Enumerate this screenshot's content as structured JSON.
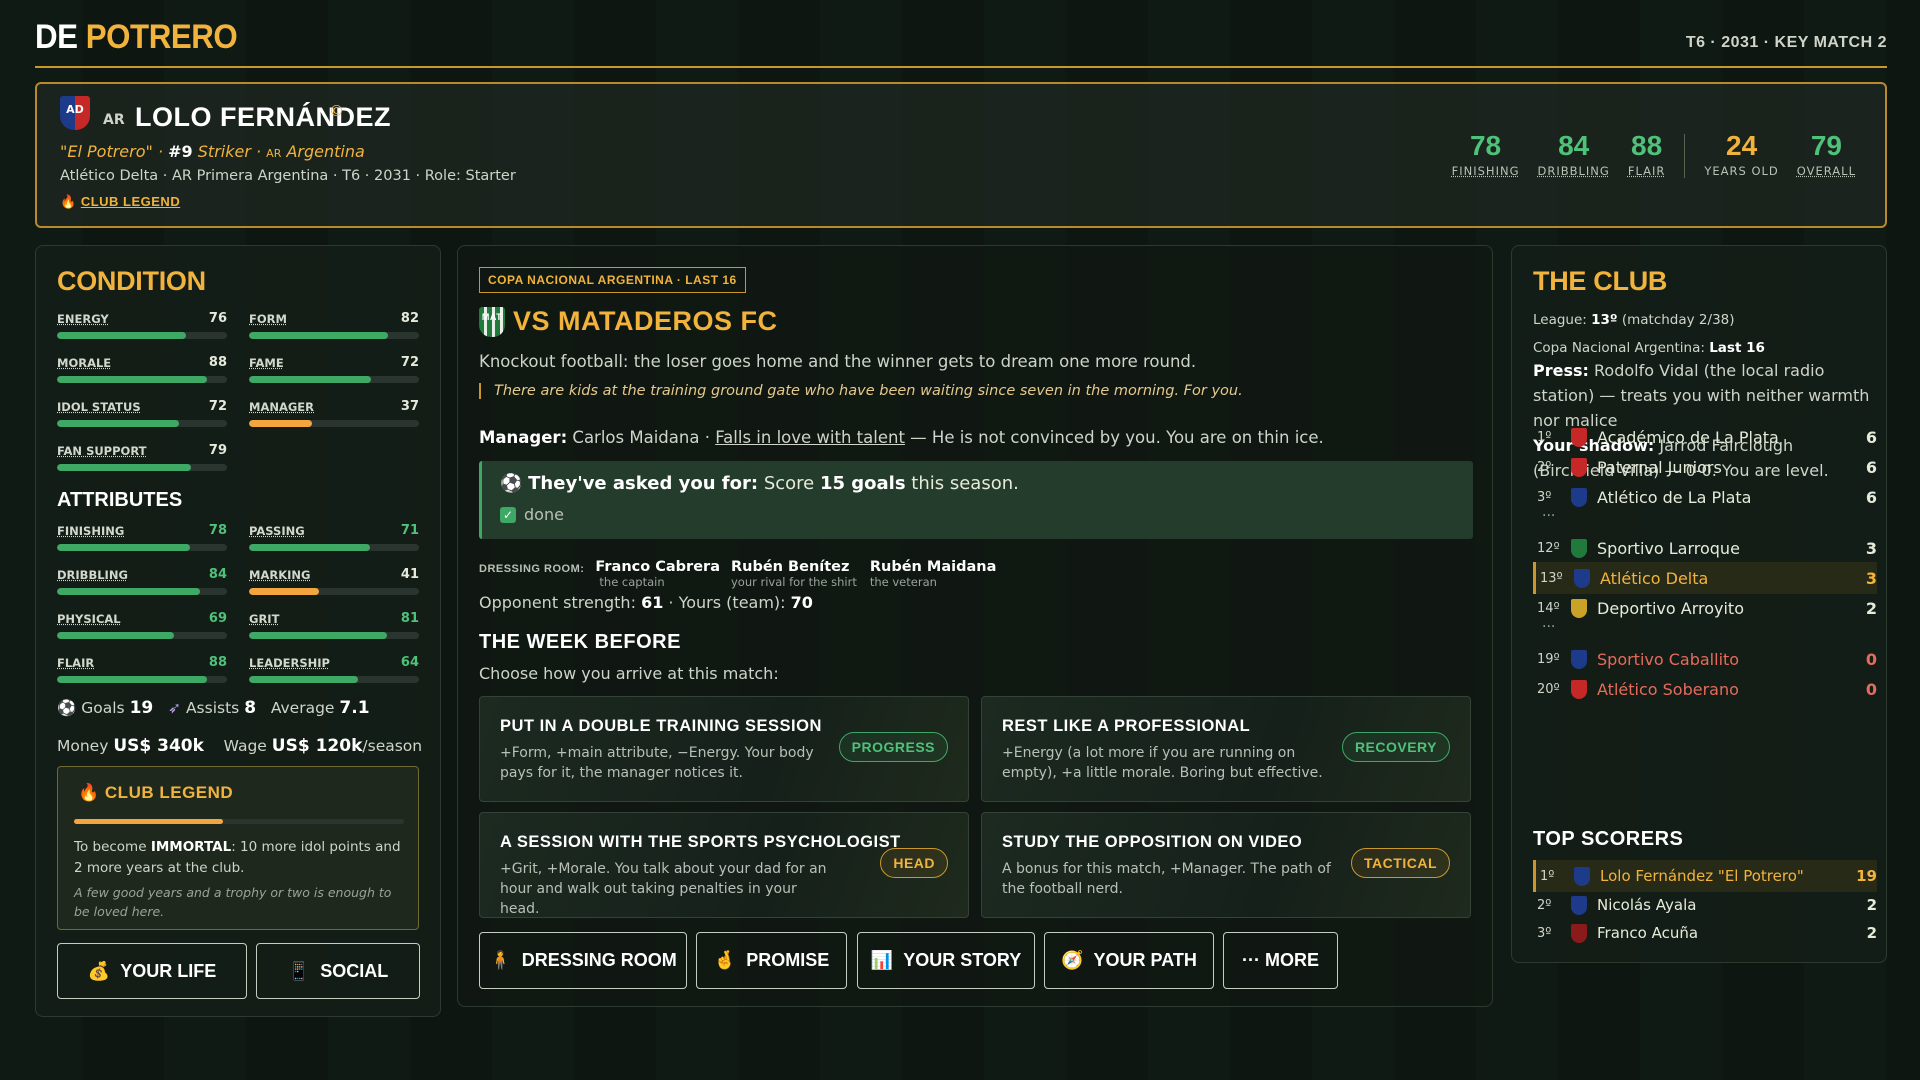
{
  "brand": {
    "part1": "DE",
    "part2": "POTRERO"
  },
  "season_info": "T6 · 2031 · KEY MATCH 2",
  "player": {
    "crest": "AD",
    "nationality": "AR",
    "name": "LOLO FERNÁNDEZ",
    "nickname": "\"El Potrero\"",
    "number": "#9",
    "position": "Striker",
    "nat_code": "AR",
    "country": "Argentina",
    "club_line": "Atlético Delta · AR Primera Argentina · T6 · 2031 · Role: Starter",
    "legend_label": "CLUB LEGEND",
    "stats": [
      {
        "label": "FINISHING",
        "value": "78"
      },
      {
        "label": "DRIBBLING",
        "value": "84"
      },
      {
        "label": "FLAIR",
        "value": "88"
      },
      {
        "label": "YEARS OLD",
        "value": "24"
      },
      {
        "label": "OVERALL",
        "value": "79"
      }
    ]
  },
  "condition": {
    "title": "CONDITION",
    "items": [
      {
        "label": "ENERGY",
        "value": "76",
        "level": 0.76,
        "color": "green"
      },
      {
        "label": "FORM",
        "value": "82",
        "level": 0.82,
        "color": "green"
      },
      {
        "label": "MORALE",
        "value": "88",
        "level": 0.88,
        "color": "green"
      },
      {
        "label": "FAME",
        "value": "72",
        "level": 0.72,
        "color": "green"
      },
      {
        "label": "IDOL STATUS",
        "value": "72",
        "level": 0.72,
        "color": "green"
      },
      {
        "label": "MANAGER",
        "value": "37",
        "level": 0.37,
        "color": "orange"
      },
      {
        "label": "FAN SUPPORT",
        "value": "79",
        "level": 0.79,
        "color": "green"
      }
    ]
  },
  "attributes": {
    "title": "ATTRIBUTES",
    "items": [
      {
        "label": "FINISHING",
        "value": "78",
        "level": 0.78,
        "color": "green"
      },
      {
        "label": "PASSING",
        "value": "71",
        "level": 0.71,
        "color": "green"
      },
      {
        "label": "DRIBBLING",
        "value": "84",
        "level": 0.84,
        "color": "green"
      },
      {
        "label": "MARKING",
        "value": "41",
        "level": 0.41,
        "color": "orange"
      },
      {
        "label": "PHYSICAL",
        "value": "69",
        "level": 0.69,
        "color": "green"
      },
      {
        "label": "GRIT",
        "value": "81",
        "level": 0.81,
        "color": "green"
      },
      {
        "label": "FLAIR",
        "value": "88",
        "level": 0.88,
        "color": "green"
      },
      {
        "label": "LEADERSHIP",
        "value": "64",
        "level": 0.64,
        "color": "green"
      }
    ]
  },
  "season_stats": {
    "goals_label": "Goals",
    "goals": "19",
    "assists_label": "Assists",
    "assists": "8",
    "average_label": "Average",
    "average": "7.1",
    "money_label": "Money",
    "money": "US$ 340k",
    "wage_label": "Wage",
    "wage": "US$ 120k",
    "wage_unit": "/season"
  },
  "legend_box": {
    "title": "CLUB LEGEND",
    "progress": 0.45,
    "text_pre": "To become ",
    "text_bold": "IMMORTAL",
    "text_post": ": 10 more idol points and 2 more years at the club.",
    "note": "A few good years and a trophy or two is enough to be loved here."
  },
  "left_buttons": {
    "life": "YOUR LIFE",
    "social": "SOCIAL"
  },
  "match": {
    "competition": "COPA NACIONAL ARGENTINA · LAST 16",
    "opp_crest": "MAT",
    "title": "VS MATADEROS FC",
    "description": "Knockout football: the loser goes home and the winner gets to dream one more round.",
    "quote": "There are kids at the training ground gate who have been waiting since seven in the morning. For you.",
    "manager_label": "Manager:",
    "manager_name": "Carlos Maidana",
    "manager_trait": "Falls in love with talent",
    "manager_note": "— He is not convinced by you. You are on thin ice.",
    "ask_label": "They've asked you for:",
    "ask_pre": "Score ",
    "ask_bold": "15 goals",
    "ask_post": " this season.",
    "ask_status": "done",
    "dressing_label": "DRESSING ROOM:",
    "dressing": [
      {
        "name": "Franco Cabrera",
        "role": "the captain"
      },
      {
        "name": "Rubén Benítez",
        "role": "your rival for the shirt"
      },
      {
        "name": "Rubén Maidana",
        "role": "the veteran"
      }
    ],
    "opp_strength_label": "Opponent strength:",
    "opp_strength": "61",
    "yours_label": "Yours (team):",
    "yours": "70",
    "week_title": "THE WEEK BEFORE",
    "week_sub": "Choose how you arrive at this match:",
    "options": [
      {
        "title": "PUT IN A DOUBLE TRAINING SESSION",
        "desc": "+Form, +main attribute, −Energy. Your body pays for it, the manager notices it.",
        "tag": "PROGRESS",
        "tag_color": "green"
      },
      {
        "title": "REST LIKE A PROFESSIONAL",
        "desc": "+Energy (a lot more if you are running on empty), +a little morale. Boring but effective.",
        "tag": "RECOVERY",
        "tag_color": "green"
      },
      {
        "title": "A SESSION WITH THE SPORTS PSYCHOLOGIST",
        "desc": "+Grit, +Morale. You talk about your dad for an hour and walk out taking penalties in your head.",
        "tag": "HEAD",
        "tag_color": "gold"
      },
      {
        "title": "STUDY THE OPPOSITION ON VIDEO",
        "desc": "A bonus for this match, +Manager. The path of the football nerd.",
        "tag": "TACTICAL",
        "tag_color": "gold"
      }
    ],
    "actions": [
      "DRESSING ROOM",
      "PROMISE",
      "YOUR STORY",
      "YOUR PATH",
      "··· MORE"
    ]
  },
  "club": {
    "title": "THE CLUB",
    "league_label": "League:",
    "league_pos": "13º",
    "league_rest": "(matchday 2/38)",
    "cup_label": "Copa Nacional Argentina:",
    "cup_status": "Last 16",
    "press_label": "Press:",
    "press_text": "Rodolfo Vidal (the local radio station) — treats you with neither warmth nor malice",
    "shadow_label": "Your shadow:",
    "shadow_text": "Jarrod Fairclough (Birchfield Villa) — 0-0. You are level.",
    "table": [
      {
        "pos": "1º",
        "team": "Académico de La Plata",
        "pts": "6",
        "crest_color": "#c62828"
      },
      {
        "pos": "2º",
        "team": "Paternal Juniors",
        "pts": "6",
        "crest_color": "#c62828"
      },
      {
        "pos": "3º",
        "team": "Atlético de La Plata",
        "pts": "6",
        "crest_color": "#1e3a8a"
      },
      {
        "pos": "12º",
        "team": "Sportivo Larroque",
        "pts": "3",
        "crest_color": "#1f7a3b"
      },
      {
        "pos": "13º",
        "team": "Atlético Delta",
        "pts": "3",
        "crest_color": "#1e3a8a"
      },
      {
        "pos": "14º",
        "team": "Deportivo Arroyito",
        "pts": "2",
        "crest_color": "#c9a227"
      },
      {
        "pos": "19º",
        "team": "Sportivo Caballito",
        "pts": "0",
        "crest_color": "#1e3a8a"
      },
      {
        "pos": "20º",
        "team": "Atlético Soberano",
        "pts": "0",
        "crest_color": "#c62828"
      }
    ],
    "ellipsis": "···",
    "scorers_title": "TOP SCORERS",
    "scorers": [
      {
        "pos": "1º",
        "name": "Lolo Fernández \"El Potrero\"",
        "goals": "19",
        "crest_color": "#1e3a8a"
      },
      {
        "pos": "2º",
        "name": "Nicolás Ayala",
        "goals": "2",
        "crest_color": "#1e3a8a"
      },
      {
        "pos": "3º",
        "name": "Franco Acuña",
        "goals": "2",
        "crest_color": "#8b1a1a"
      }
    ]
  }
}
